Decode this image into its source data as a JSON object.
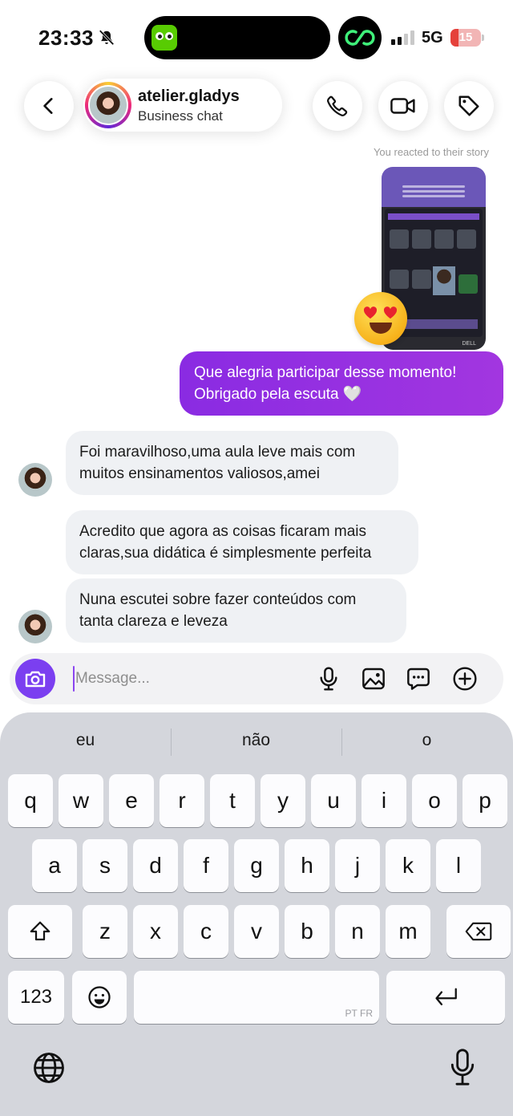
{
  "status_bar": {
    "time": "23:33",
    "network": "5G",
    "battery": "15",
    "battery_level_percent": 15,
    "icons": [
      "bell-slash-icon",
      "duolingo-app-icon",
      "threads-app-icon",
      "cellular-signal-icon"
    ]
  },
  "header": {
    "contact_name": "atelier.gladys",
    "contact_subtitle": "Business chat",
    "icons": [
      "back-icon",
      "phone-icon",
      "video-camera-icon",
      "tag-icon"
    ]
  },
  "story_reply": {
    "note": "You reacted to their story",
    "reaction": "heart-eyes-emoji",
    "brand_text": "DELL"
  },
  "messages": [
    {
      "from": "me",
      "text_line1": "Que alegria participar desse momento!",
      "text_line2": "Obrigado pela escuta 🤍"
    },
    {
      "from": "them",
      "text_line1": "Foi maravilhoso,uma aula leve mais com",
      "text_line2": "muitos ensinamentos valiosos,amei"
    },
    {
      "from": "them",
      "text_line1": "Acredito que agora as coisas ficaram mais",
      "text_line2": "claras,sua didática é simplesmente perfeita"
    },
    {
      "from": "them",
      "text_line1": "Nuna escutei sobre fazer conteúdos com",
      "text_line2": "tanta clareza e leveza"
    }
  ],
  "composer": {
    "placeholder": "Message...",
    "icons": [
      "camera-icon",
      "microphone-icon",
      "gallery-icon",
      "sticker-icon",
      "add-icon"
    ],
    "accent": "#7b3ff0"
  },
  "keyboard": {
    "suggestions": [
      "eu",
      "não",
      "o"
    ],
    "row1": [
      "q",
      "w",
      "e",
      "r",
      "t",
      "y",
      "u",
      "i",
      "o",
      "p"
    ],
    "row2": [
      "a",
      "s",
      "d",
      "f",
      "g",
      "h",
      "j",
      "k",
      "l"
    ],
    "row3": [
      "z",
      "x",
      "c",
      "v",
      "b",
      "n",
      "m"
    ],
    "numbers_key": "123",
    "space_languages": "PT FR",
    "icons": [
      "shift-icon",
      "backspace-icon",
      "emoji-icon",
      "return-icon",
      "globe-icon",
      "dictation-mic-icon"
    ]
  },
  "colors": {
    "outgoing_bubble": "#8a2be2",
    "incoming_bubble": "#eff1f4",
    "keyboard_bg": "#d4d6dc"
  }
}
